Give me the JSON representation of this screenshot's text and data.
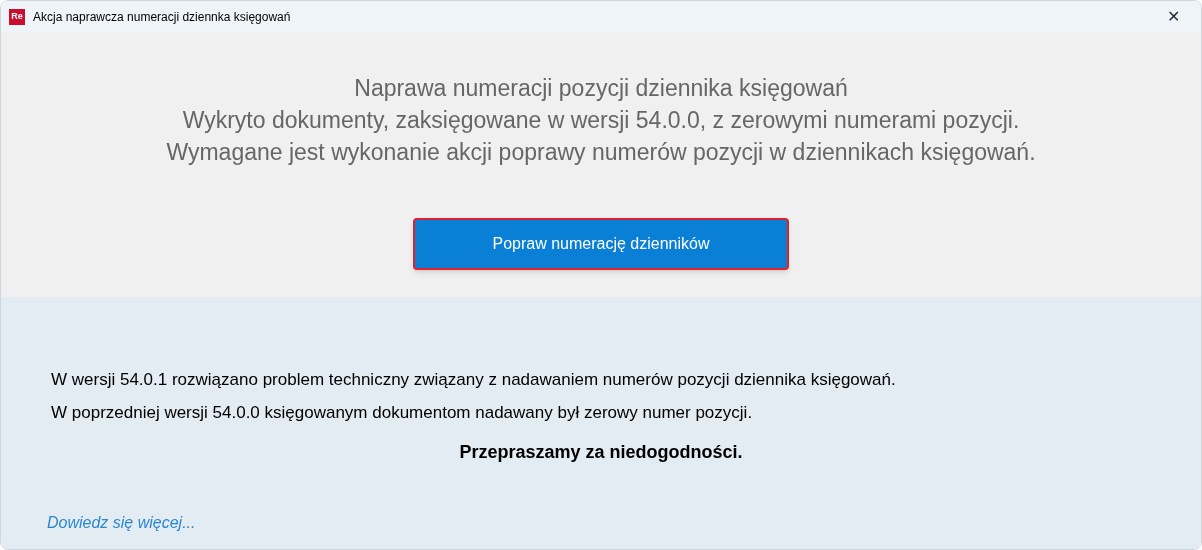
{
  "window": {
    "title": "Akcja naprawcza numeracji dziennka księgowań",
    "app_badge": "Re",
    "close": "✕"
  },
  "header": {
    "lines": [
      "Naprawa numeracji pozycji dziennika księgowań",
      "Wykryto dokumenty, zaksięgowane w wersji 54.0.0, z zerowymi numerami pozycji.",
      "Wymagane jest wykonanie akcji poprawy numerów pozycji w dziennikach księgowań."
    ],
    "button": "Popraw numerację dzienników"
  },
  "info": {
    "lines": [
      "W wersji 54.0.1 rozwiązano problem techniczny związany z nadawaniem numerów pozycji dziennika księgowań.",
      "W poprzedniej wersji 54.0.0 księgowanym dokumentom nadawany był zerowy numer pozycji."
    ],
    "apology": "Przepraszamy za niedogodności.",
    "link": "Dowiedz się więcej..."
  }
}
